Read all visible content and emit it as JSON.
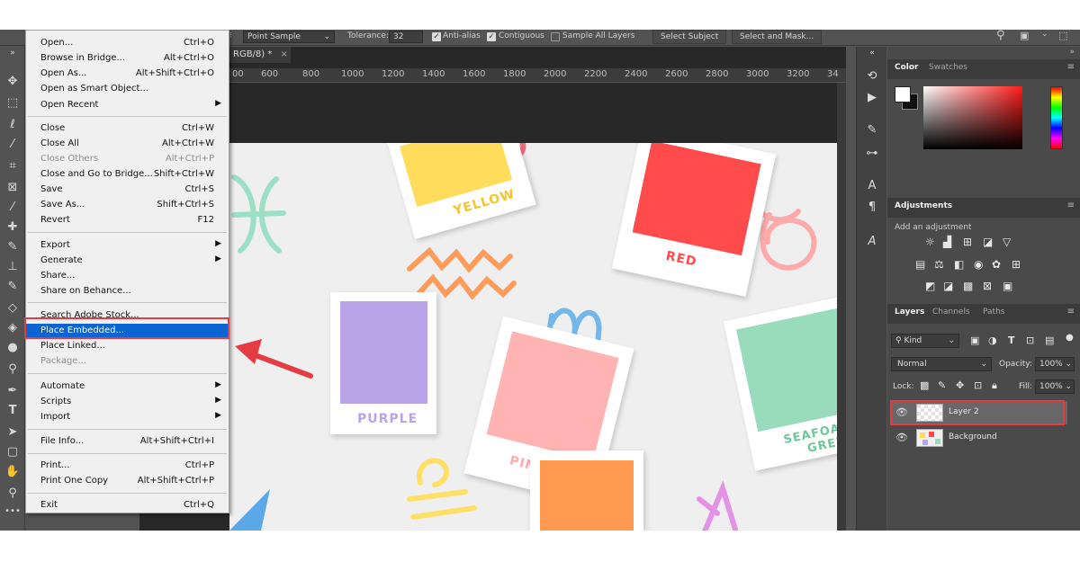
{
  "options_bar": {
    "sample_size": "Point Sample",
    "tolerance_label": "Tolerance:",
    "tolerance_value": "32",
    "anti_alias_label": "Anti-alias",
    "contiguous_label": "Contiguous",
    "sample_all_label": "Sample All Layers",
    "select_subject": "Select Subject",
    "select_mask": "Select and Mask..."
  },
  "document": {
    "tab_title": "RGB/8) *",
    "tab_close": "×",
    "ruler_ticks": [
      "600",
      "800",
      "1000",
      "1200",
      "1400",
      "1600",
      "1800",
      "2000",
      "2200",
      "2400",
      "2600",
      "2800",
      "3000",
      "3200",
      "34"
    ],
    "ruler_lead": "00"
  },
  "file_menu": {
    "items": [
      {
        "label": "Open...",
        "shortcut": "Ctrl+O"
      },
      {
        "label": "Browse in Bridge...",
        "shortcut": "Alt+Ctrl+O"
      },
      {
        "label": "Open As...",
        "shortcut": "Alt+Shift+Ctrl+O"
      },
      {
        "label": "Open as Smart Object...",
        "shortcut": ""
      },
      {
        "label": "Open Recent",
        "shortcut": ""
      },
      {
        "label": "Close",
        "shortcut": "Ctrl+W"
      },
      {
        "label": "Close All",
        "shortcut": "Alt+Ctrl+W"
      },
      {
        "label": "Close Others",
        "shortcut": "Alt+Ctrl+P"
      },
      {
        "label": "Close and Go to Bridge...",
        "shortcut": "Shift+Ctrl+W"
      },
      {
        "label": "Save",
        "shortcut": "Ctrl+S"
      },
      {
        "label": "Save As...",
        "shortcut": "Shift+Ctrl+S"
      },
      {
        "label": "Revert",
        "shortcut": "F12"
      },
      {
        "label": "Export",
        "shortcut": ""
      },
      {
        "label": "Generate",
        "shortcut": ""
      },
      {
        "label": "Share...",
        "shortcut": ""
      },
      {
        "label": "Share on Behance...",
        "shortcut": ""
      },
      {
        "label": "Search Adobe Stock...",
        "shortcut": ""
      },
      {
        "label": "Place Embedded...",
        "shortcut": ""
      },
      {
        "label": "Place Linked...",
        "shortcut": ""
      },
      {
        "label": "Package...",
        "shortcut": ""
      },
      {
        "label": "Automate",
        "shortcut": ""
      },
      {
        "label": "Scripts",
        "shortcut": ""
      },
      {
        "label": "Import",
        "shortcut": ""
      },
      {
        "label": "File Info...",
        "shortcut": "Alt+Shift+Ctrl+I"
      },
      {
        "label": "Print...",
        "shortcut": "Ctrl+P"
      },
      {
        "label": "Print One Copy",
        "shortcut": "Alt+Shift+Ctrl+P"
      },
      {
        "label": "Exit",
        "shortcut": "Ctrl+Q"
      }
    ]
  },
  "canvas_cards": {
    "yellow": {
      "label": "YELLOW",
      "color": "#ffdc5c"
    },
    "red": {
      "label": "RED",
      "color": "#ff4b4b"
    },
    "purple": {
      "label": "PURPLE",
      "color": "#b8a4e6"
    },
    "pink": {
      "label": "PINK",
      "color": "#ffb3b3"
    },
    "seafoam_line1": "SEAFOA",
    "seafoam_line2": "GREE",
    "seafoam_color": "#98dcbc",
    "orange_color": "#ff9a50"
  },
  "color_panel": {
    "tab_color": "Color",
    "tab_swatches": "Swatches"
  },
  "adjustments_panel": {
    "title": "Adjustments",
    "hint": "Add an adjustment"
  },
  "layers_panel": {
    "tab_layers": "Layers",
    "tab_channels": "Channels",
    "tab_paths": "Paths",
    "filter_kind": "Kind",
    "blend_mode": "Normal",
    "opacity_label": "Opacity:",
    "opacity_value": "100%",
    "lock_label": "Lock:",
    "fill_label": "Fill:",
    "fill_value": "100%",
    "layers": [
      "Layer 2",
      "Background"
    ]
  },
  "colors": {
    "highlight": "#0a64d2",
    "callout": "#e53b43"
  }
}
